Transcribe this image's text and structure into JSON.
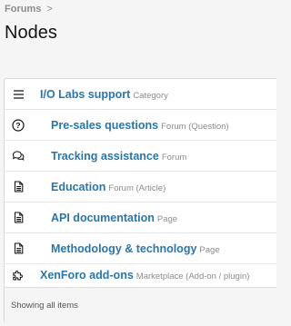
{
  "breadcrumb": {
    "items": [
      "Forums"
    ],
    "separator": ">"
  },
  "page_title": "Nodes",
  "nodes": [
    {
      "title": "I/O Labs support",
      "type": "Category",
      "icon": "bars-icon",
      "depth": 0
    },
    {
      "title": "Pre-sales questions",
      "type": "Forum (Question)",
      "icon": "question-circle-icon",
      "depth": 1
    },
    {
      "title": "Tracking assistance",
      "type": "Forum",
      "icon": "comments-icon",
      "depth": 1
    },
    {
      "title": "Education",
      "type": "Forum (Article)",
      "icon": "file-text-icon",
      "depth": 1
    },
    {
      "title": "API documentation",
      "type": "Page",
      "icon": "file-text-icon",
      "depth": 1
    },
    {
      "title": "Methodology & technology",
      "type": "Page",
      "icon": "file-text-icon",
      "depth": 1
    },
    {
      "title": "XenForo add-ons",
      "type": "Marketplace (Add-on / plugin)",
      "icon": "puzzle-icon",
      "depth": 0
    }
  ],
  "footer": {
    "text": "Showing all items"
  },
  "colors": {
    "link": "#2577b1",
    "muted": "#8c8c8c",
    "background": "#f5f5f5"
  }
}
